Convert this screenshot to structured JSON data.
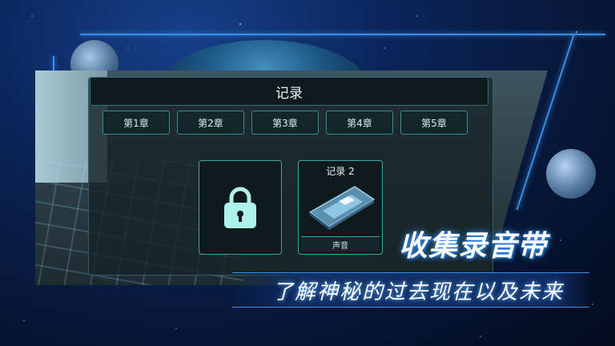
{
  "dialog": {
    "title": "记录"
  },
  "tabs": [
    {
      "label": "第1章"
    },
    {
      "label": "第2章"
    },
    {
      "label": "第3章"
    },
    {
      "label": "第4章"
    },
    {
      "label": "第5章"
    }
  ],
  "cards": {
    "locked": {
      "icon": "padlock-icon"
    },
    "record": {
      "title": "记录 2",
      "footer": "声音",
      "icon": "cassette-tape-icon"
    }
  },
  "promo": {
    "headline": "收集录音带",
    "subline": "了解神秘的过去现在以及未来"
  },
  "colors": {
    "accent": "#3fa3ff",
    "card_border": "#3fa3a8"
  }
}
